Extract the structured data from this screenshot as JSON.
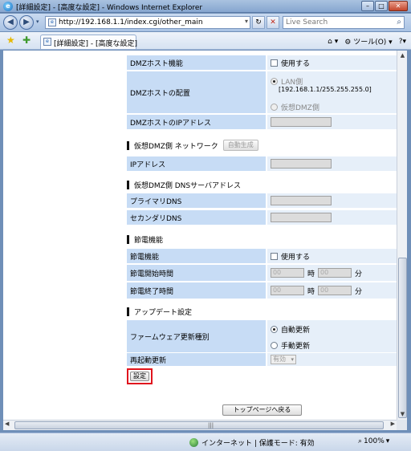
{
  "window": {
    "title": "[詳細設定] - [高度な設定] - Windows Internet Explorer",
    "url": "http://192.168.1.1/index.cgi/other_main",
    "search_placeholder": "Live Search",
    "tab_label": "[詳細設定] - [高度な設定]",
    "tools_label": "ツール(O)"
  },
  "dmz": {
    "host_function_label": "DMZホスト機能",
    "host_function_value": "使用する",
    "placement_label": "DMZホストの配置",
    "lan_option": "LAN側",
    "lan_address": "[192.168.1.1/255.255.255.0]",
    "virtual_option": "仮想DMZ側",
    "ip_label": "DMZホストのIPアドレス"
  },
  "virtual_network": {
    "heading": "仮想DMZ側 ネットワーク",
    "autogen_button": "自動生成",
    "ip_label": "IPアドレス"
  },
  "virtual_dns": {
    "heading": "仮想DMZ側 DNSサーバアドレス",
    "primary_label": "プライマリDNS",
    "secondary_label": "セカンダリDNS"
  },
  "power_saving": {
    "heading": "節電機能",
    "function_label": "節電機能",
    "function_value": "使用する",
    "start_label": "節電開始時間",
    "end_label": "節電終了時間",
    "hour_unit": "時",
    "minute_unit": "分",
    "placeholder_value": "00"
  },
  "update": {
    "heading": "アップデート設定",
    "firmware_label": "ファームウェア更新種別",
    "auto_option": "自動更新",
    "manual_option": "手動更新",
    "restart_label": "再起動更新",
    "restart_value": "有効"
  },
  "actions": {
    "apply_button": "設定",
    "top_page_button": "トップページへ戻る"
  },
  "status": {
    "zone_text": "インターネット | 保護モード: 有効",
    "zoom": "100%"
  }
}
